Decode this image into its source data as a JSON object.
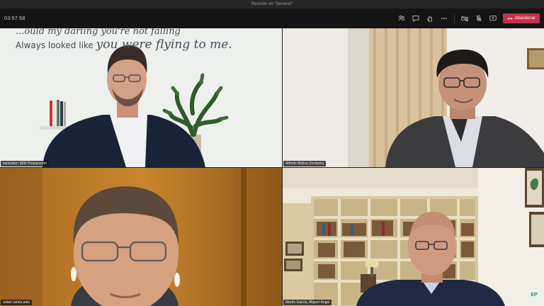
{
  "window": {
    "title": "Reunión en \"General\""
  },
  "toolbar": {
    "timer": "03:57:58",
    "leave_label": "Abandonar"
  },
  "wall_text": {
    "line1": "...ould my darling you're not falling",
    "line2_prefix": "Always looked like ",
    "line2_rest": "you were flying to me."
  },
  "participants": [
    {
      "name": "sonmaton SER Preparacion"
    },
    {
      "name": "Alfredo Molina (Invitado)"
    },
    {
      "name": "rafael catala polo"
    },
    {
      "name": "Martín García, Miguel Ángel"
    }
  ],
  "overlay": {
    "logo_text": "EP"
  }
}
